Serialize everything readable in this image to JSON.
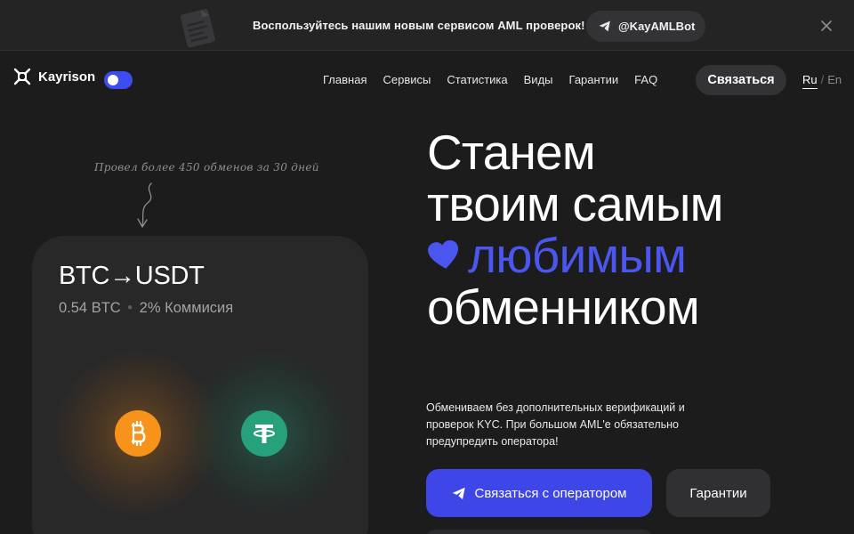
{
  "banner": {
    "text": "Воспользуйтесь нашим новым сервисом AML проверок!",
    "bot_handle": "@KayAMLBot",
    "icons": [
      "document-icon",
      "telegram-icon",
      "close-icon"
    ]
  },
  "header": {
    "logo_text": "Kayrison",
    "nav": [
      "Главная",
      "Сервисы",
      "Статистика",
      "Виды",
      "Гарантии",
      "FAQ"
    ],
    "contact_label": "Связаться",
    "lang": {
      "ru": "Ru",
      "sep": "/",
      "en": "En"
    },
    "toggle_on": true
  },
  "card": {
    "handnote": "Провел более 450 обменов за 30 дней",
    "pair": "BTC→USDT",
    "amount": "0.54 BTC",
    "dot": "•",
    "commission": "2% Коммисия",
    "coins": [
      "bitcoin-icon",
      "tether-icon"
    ]
  },
  "hero": {
    "line1": "Станем",
    "line2": "твоим самым",
    "line3": "любимым",
    "line4": "обменником",
    "subtext": "Обмениваем без дополнительных верификаций и проверок KYC. При большом AML'е обязательно предупредить оператора!",
    "primary_label": "Связаться с оператором",
    "secondary_label": "Гарантии"
  },
  "colors": {
    "background": "#1c1c1d",
    "accent": "#4b56ee",
    "button_primary": "#3f46e8",
    "btc": "#f7931a",
    "usdt": "#26a17b"
  }
}
